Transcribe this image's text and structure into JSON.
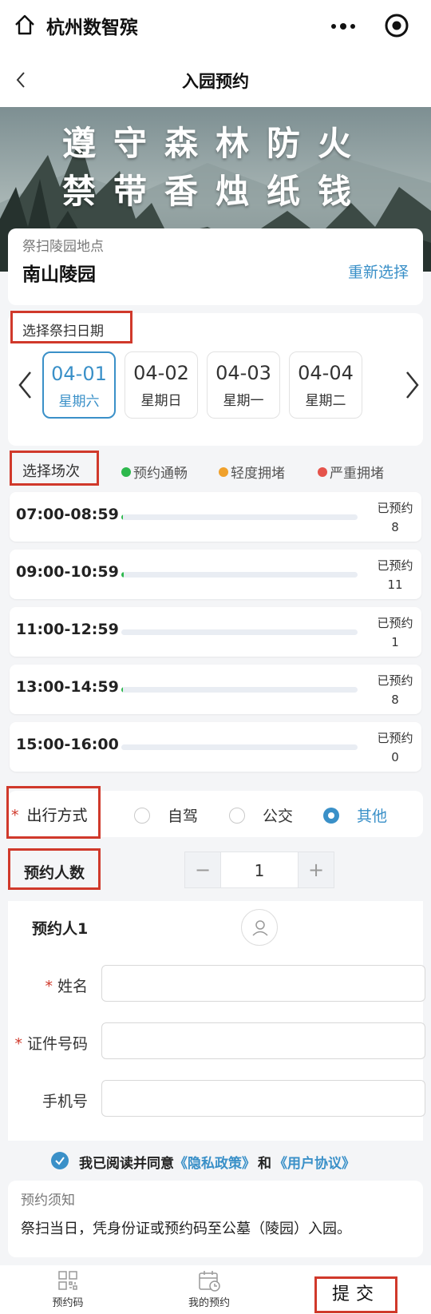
{
  "app": {
    "name": "杭州数智殡"
  },
  "nav": {
    "title": "入园预约"
  },
  "banner": {
    "line1": "遵守森林防火",
    "line2": "禁带香烛纸钱"
  },
  "location": {
    "label": "祭扫陵园地点",
    "name": "南山陵园",
    "reselect": "重新选择"
  },
  "date_section": {
    "label": "选择祭扫日期",
    "dates": [
      {
        "date": "04-01",
        "weekday": "星期六",
        "selected": true
      },
      {
        "date": "04-02",
        "weekday": "星期日",
        "selected": false
      },
      {
        "date": "04-03",
        "weekday": "星期一",
        "selected": false
      },
      {
        "date": "04-04",
        "weekday": "星期二",
        "selected": false
      }
    ]
  },
  "session_section": {
    "label": "选择场次",
    "legend": [
      {
        "label": "预约通畅",
        "color": "#2db84d"
      },
      {
        "label": "轻度拥堵",
        "color": "#f0a12c"
      },
      {
        "label": "严重拥堵",
        "color": "#e5534b"
      }
    ],
    "booked_label": "已预约",
    "slots": [
      {
        "time": "07:00-08:59",
        "booked": "8",
        "fill_fraction": 0.008
      },
      {
        "time": "09:00-10:59",
        "booked": "11",
        "fill_fraction": 0.01
      },
      {
        "time": "11:00-12:59",
        "booked": "1",
        "fill_fraction": 0.0
      },
      {
        "time": "13:00-14:59",
        "booked": "8",
        "fill_fraction": 0.008
      },
      {
        "time": "15:00-16:00",
        "booked": "0",
        "fill_fraction": 0.0
      }
    ]
  },
  "travel": {
    "required_mark": "*",
    "label": "出行方式",
    "options": [
      {
        "label": "自驾",
        "selected": false
      },
      {
        "label": "公交",
        "selected": false
      },
      {
        "label": "其他",
        "selected": true
      }
    ]
  },
  "count": {
    "label": "预约人数",
    "value": "1",
    "minus": "−",
    "plus": "+"
  },
  "person": {
    "title": "预约人1",
    "fields": [
      {
        "label": "姓名",
        "required": true,
        "value": ""
      },
      {
        "label": "证件号码",
        "required": true,
        "value": ""
      },
      {
        "label": "手机号",
        "required": false,
        "value": ""
      }
    ]
  },
  "agreement": {
    "prefix": "我已阅读并同意",
    "privacy": "《隐私政策》",
    "and": "和",
    "terms": "《用户协议》",
    "checked": true
  },
  "notice": {
    "title": "预约须知",
    "body": "祭扫当日，凭身份证或预约码至公墓（陵园）入园。"
  },
  "bottom": {
    "tab1": "预约码",
    "tab2": "我的预约",
    "submit": "提交"
  },
  "colors": {
    "accent": "#3a90c8",
    "highlight_border": "#d0392b"
  }
}
